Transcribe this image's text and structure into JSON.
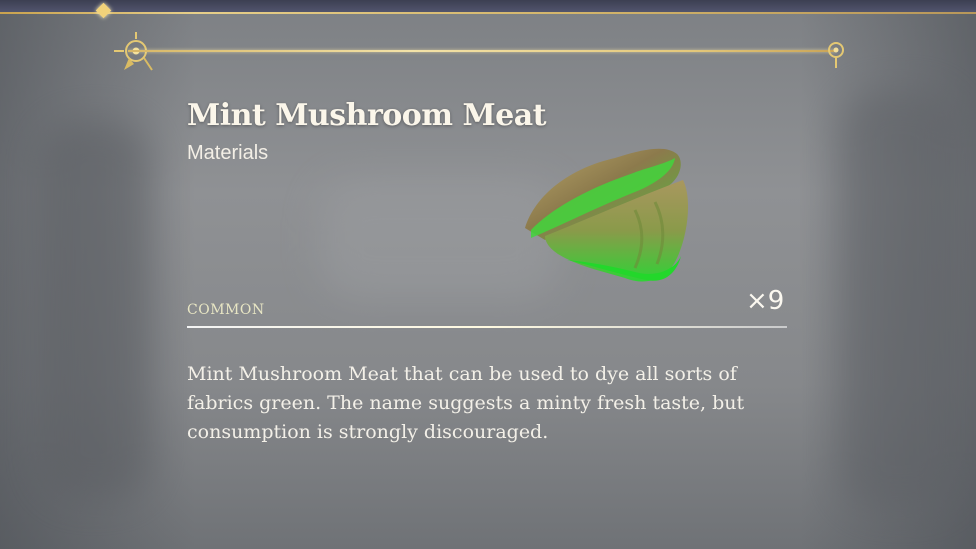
{
  "item": {
    "name": "Mint Mushroom Meat",
    "category": "Materials",
    "rarity": "COMMON",
    "quantity": "×9",
    "description": "Mint Mushroom Meat that can be used to dye all sorts of fabrics green. The name suggests a minty fresh taste, but consumption is strongly discouraged.",
    "icon": "mint-mushroom-meat-icon"
  },
  "colors": {
    "gold_accent": "#e3c77a",
    "item_green": "#39d33b",
    "text": "#f3f0e8"
  }
}
